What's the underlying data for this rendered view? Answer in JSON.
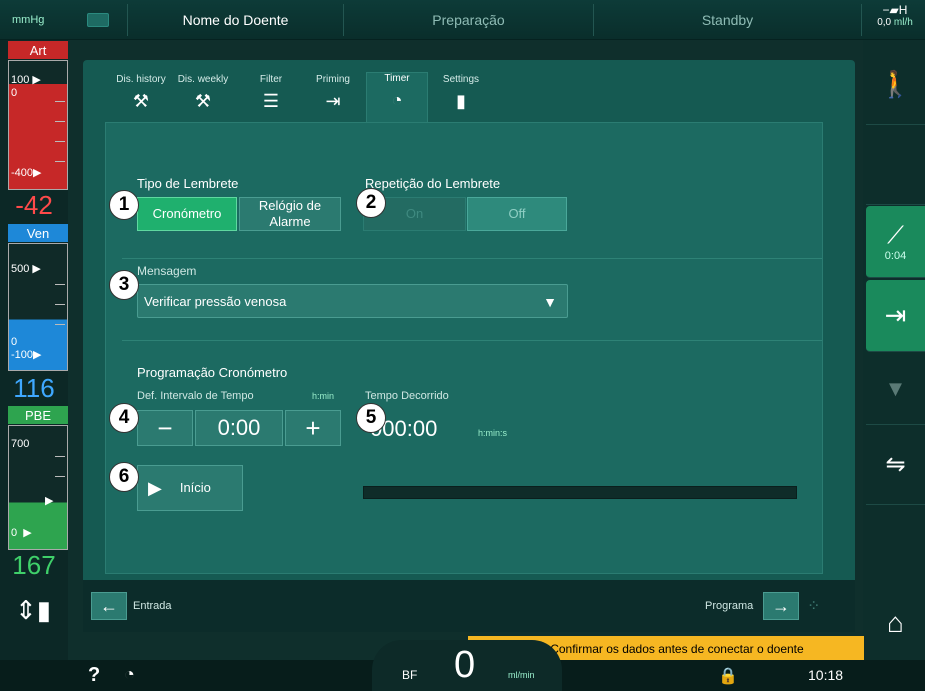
{
  "topbar": {
    "unit_mmhg": "mmHg",
    "patient_name": "Nome do Doente",
    "phase": "Preparação",
    "mode": "Standby",
    "uf_value": "0,0",
    "uf_unit": "ml/h"
  },
  "pressures": {
    "art": {
      "label": "Art",
      "top_tick": "100",
      "zero_tick": "0",
      "bottom_tick": "-400",
      "value": "-42",
      "color": "#d42a2a"
    },
    "ven": {
      "label": "Ven",
      "top_tick": "500",
      "zero_tick": "0",
      "bottom_tick": "-100",
      "value": "116",
      "color": "#2a8cd4"
    },
    "pbe": {
      "label": "PBE",
      "top_tick": "700",
      "zero_tick": "0",
      "value": "167",
      "color": "#2ea44f"
    }
  },
  "tabs": [
    {
      "label": "Dis. history",
      "icon": "dis-history-icon",
      "glyph": "⚒"
    },
    {
      "label": "Dis. weekly",
      "icon": "dis-weekly-icon",
      "glyph": "⚒"
    },
    {
      "label": "Filter",
      "icon": "filter-icon",
      "glyph": "☰"
    },
    {
      "label": "Priming",
      "icon": "priming-icon",
      "glyph": "⇥"
    },
    {
      "label": "Timer",
      "icon": "timer-icon",
      "glyph": "◔"
    },
    {
      "label": "Settings",
      "icon": "settings-icon",
      "glyph": "▮"
    }
  ],
  "reminder": {
    "type_label": "Tipo de Lembrete",
    "type_options": [
      "Cronómetro",
      "Relógio de Alarme"
    ],
    "type_selected": "Cronómetro",
    "repeat_label": "Repetição do Lembrete",
    "repeat_options": [
      "On",
      "Off"
    ],
    "repeat_selected": "Off"
  },
  "message": {
    "label": "Mensagem",
    "value": "Verificar pressão venosa"
  },
  "timer_program": {
    "title": "Programação Cronómetro",
    "interval_label": "Def. Intervalo de Tempo",
    "interval_unit": "h:min",
    "interval_value": "0:00",
    "minus": "−",
    "plus": "+",
    "elapsed_label": "Tempo Decorrido",
    "elapsed_value": "00:00",
    "elapsed_prefix": "0",
    "elapsed_unit": "h:min:s",
    "start_label": "Início",
    "progress": 0
  },
  "callouts": [
    "1",
    "2",
    "3",
    "4",
    "5",
    "6"
  ],
  "bottomnav": {
    "back_label": "Entrada",
    "next_label": "Programa"
  },
  "rightcol": {
    "timer_countdown": "0:04"
  },
  "warning": "Confirmar os dados antes de conectar o doente",
  "status": {
    "help": "?",
    "bf_label": "BF",
    "bf_value": "0",
    "bf_unit": "ml/min",
    "time": "10:18"
  },
  "colors": {
    "accent_green": "#1fb06e",
    "warning": "#f6b722",
    "panel": "#155a52"
  }
}
